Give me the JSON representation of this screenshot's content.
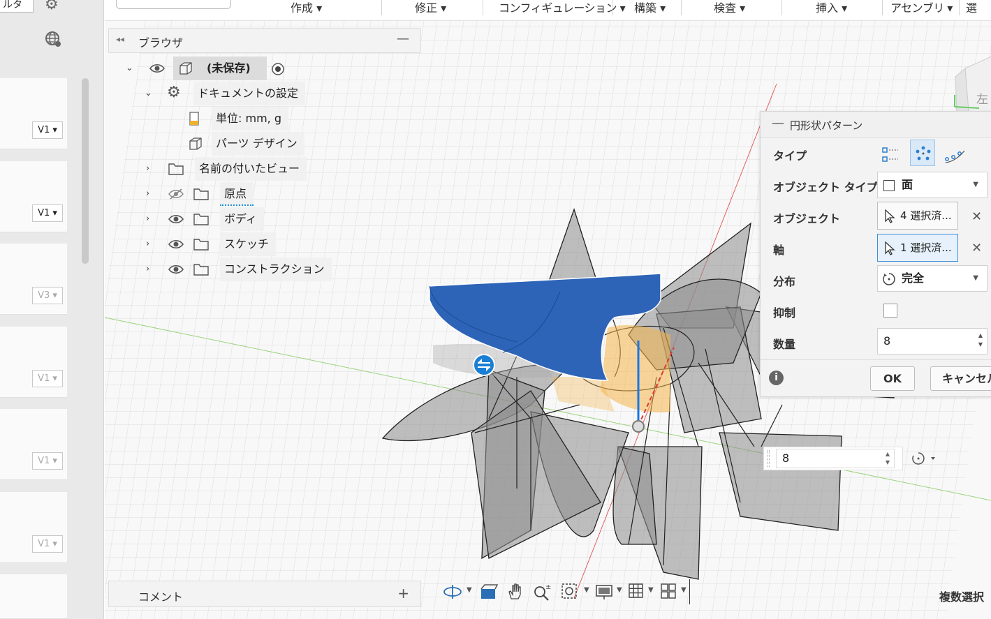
{
  "left_panel": {
    "top_label": "ルタ",
    "versions": [
      "V1",
      "V1",
      "V3",
      "V1",
      "V1",
      "V1"
    ]
  },
  "toolbar": {
    "menus": [
      "作成",
      "修正",
      "コンフィギュレーション",
      "構築",
      "検査",
      "挿入",
      "アセンブリ",
      "選"
    ]
  },
  "browser": {
    "title": "ブラウザ",
    "items": [
      {
        "label": "(未保存)"
      },
      {
        "label": "ドキュメントの設定"
      },
      {
        "label": "単位: mm, g"
      },
      {
        "label": "パーツ デザイン"
      },
      {
        "label": "名前の付いたビュー"
      },
      {
        "label": "原点"
      },
      {
        "label": "ボディ"
      },
      {
        "label": "スケッチ"
      },
      {
        "label": "コンストラクション"
      }
    ]
  },
  "dialog": {
    "title": "円形状パターン",
    "rows": {
      "type": "タイプ",
      "object_type": "オブジェクト タイプ",
      "object": "オブジェクト",
      "axis": "軸",
      "distribution": "分布",
      "suppress": "抑制",
      "quantity": "数量"
    },
    "object_type_value": "面",
    "object_value": "4 選択済...",
    "axis_value": "1 選択済...",
    "distribution_value": "完全",
    "quantity_value": "8",
    "ok_label": "OK",
    "cancel_label": "キャンセル"
  },
  "floating_count": "8",
  "comment": {
    "label": "コメント",
    "add": "+"
  },
  "status": {
    "multi_select": "複数選択"
  },
  "viewcube": {
    "face_label": "左"
  },
  "colors": {
    "accent": "#3d8fd9",
    "selection_blue": "#2e64b8",
    "highlight": "#f4b54a"
  }
}
